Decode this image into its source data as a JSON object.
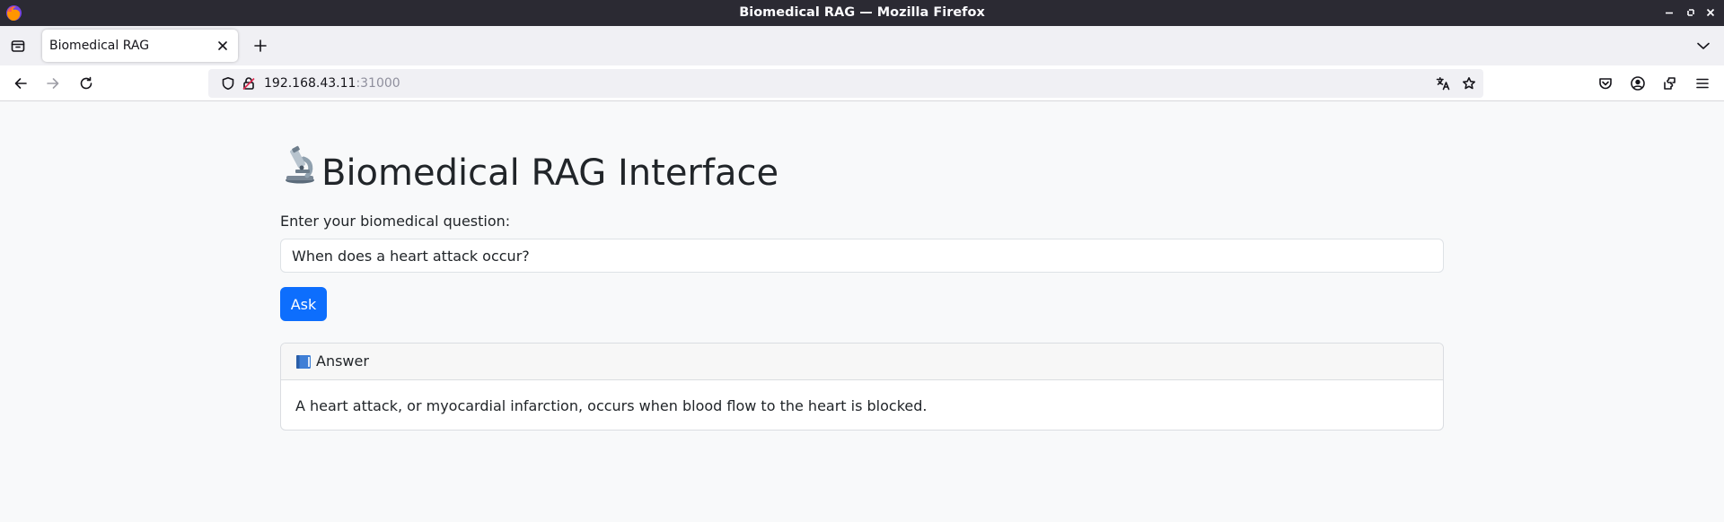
{
  "window": {
    "title": "Biomedical RAG — Mozilla Firefox"
  },
  "tabs": [
    {
      "label": "Biomedical RAG",
      "active": true
    }
  ],
  "urlbar": {
    "host": "192.168.43.11",
    "port": ":31000"
  },
  "page": {
    "title": "Biomedical RAG Interface",
    "title_icon": "microscope-icon",
    "question_label": "Enter your biomedical question:",
    "question_value": "When does a heart attack occur?",
    "ask_label": "Ask",
    "answer_header": "Answer",
    "answer_icon": "blue-book-icon",
    "answer_text": "A heart attack, or myocardial infarction, occurs when blood flow to the heart is blocked."
  },
  "colors": {
    "primary": "#0d6efd",
    "titlebar": "#2b2a33",
    "page_bg": "#f8f9fa"
  }
}
